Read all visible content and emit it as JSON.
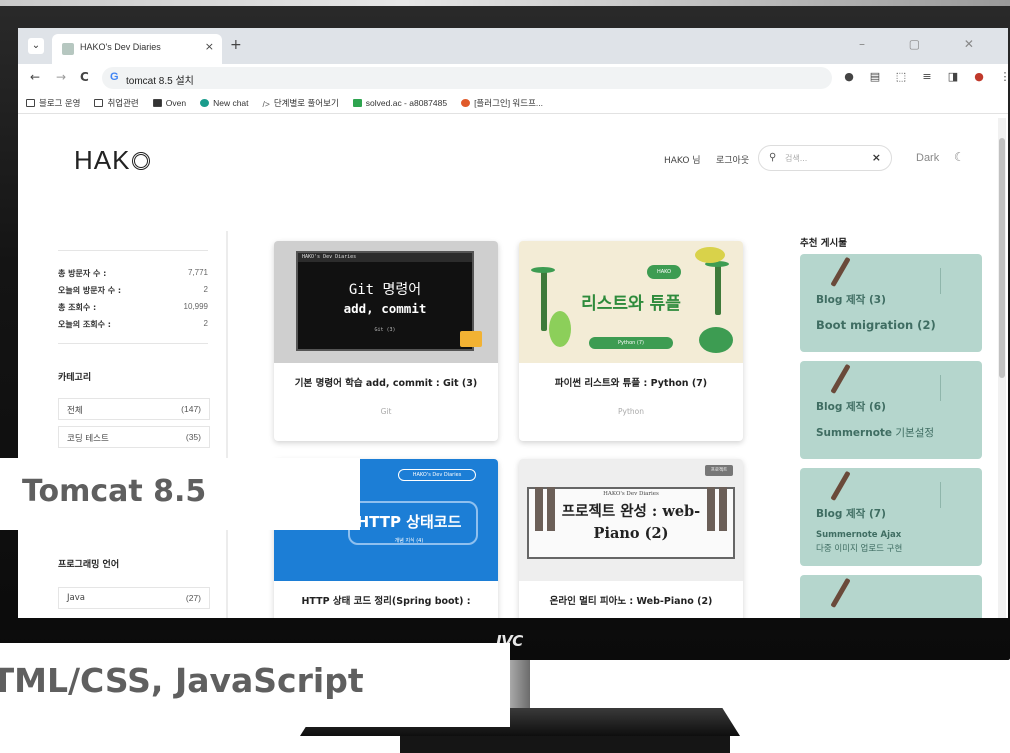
{
  "browser": {
    "tab_title": "HAKO's Dev Diaries",
    "tab_close": "×",
    "new_tab": "+",
    "window_controls": "–  ▢  ✕",
    "url": "tomcat 8.5 설치",
    "url_icon": "G",
    "nav": {
      "back": "←",
      "forward": "→",
      "reload": "C"
    },
    "bookmarks": [
      {
        "label": "블로그 운영",
        "icon": "folder-icon"
      },
      {
        "label": "취업관련",
        "icon": "folder-icon"
      },
      {
        "label": "Oven",
        "icon": "oven-icon"
      },
      {
        "label": "New chat",
        "icon": "chatgpt-icon"
      },
      {
        "label": "단계별로 풀어보기",
        "icon": "code-icon"
      },
      {
        "label": "solved.ac - a8087485",
        "icon": "solvedac-icon"
      },
      {
        "label": "[플러그인] 워드프...",
        "icon": "wordpress-icon"
      }
    ]
  },
  "header": {
    "logo": "HAK",
    "user": "HAKO 님",
    "logout": "로그아웃",
    "search_placeholder": "검색...",
    "search_clear": "×",
    "theme_label": "Dark",
    "theme_icon": "☾"
  },
  "sidebar": {
    "stats": [
      {
        "label": "총 방문자 수 :",
        "value": "7,771"
      },
      {
        "label": "오늘의 방문자 수 :",
        "value": "2"
      },
      {
        "label": "총 조회수 :",
        "value": "10,999"
      },
      {
        "label": "오늘의 조회수 :",
        "value": "2"
      }
    ],
    "category_heading": "카테고리",
    "categories": [
      {
        "name": "전체",
        "count": "(147)"
      },
      {
        "name": "코딩 테스트",
        "count": "(35)"
      }
    ],
    "lang_heading": "프로그래밍 언어",
    "lang_items": [
      {
        "name": "Java",
        "count": "(27)"
      }
    ]
  },
  "posts": [
    {
      "title": "기본 명령어 학습 add, commit : Git (3)",
      "category": "Git",
      "thumb_bar": "HAKO's Dev Diaries",
      "thumb_line1": "Git 명령어",
      "thumb_line2": "add, commit",
      "thumb_line3": "Git (3)"
    },
    {
      "title": "파이썬 리스트와 튜플 : Python (7)",
      "category": "Python",
      "thumb_title": "리스트와 튜플",
      "thumb_pill": "Python (7)",
      "thumb_tag": "HAKO"
    },
    {
      "title": "HTTP 상태 코드 정리(Spring boot) :",
      "category": "",
      "thumb_pill": "HAKO's Dev Diaries",
      "thumb_text": "HTTP 상태코드",
      "thumb_sub": "개념 지식 (4)"
    },
    {
      "title": "온라인 멀티 피아노 : Web-Piano (2)",
      "category": "",
      "thumb_head": "HAKO's Dev Diaries",
      "thumb_title": "프로젝트 완성 : web-Piano (2)",
      "thumb_badge": "프로젝트"
    }
  ],
  "recommended": {
    "heading": "추천 게시물",
    "items": [
      {
        "line1": "Blog 제작 (3)",
        "line2": "Boot migration (2)",
        "line3": ""
      },
      {
        "line1": "Blog 제작 (6)",
        "line2_bold": "Summernote",
        "line2_light": " 기본설정",
        "line3": ""
      },
      {
        "line1": "Blog 제작 (7)",
        "line2": "Summernote  Ajax",
        "line3": "다중 이미지 업로드 구현"
      }
    ]
  },
  "monitor": {
    "brand": "JVC"
  },
  "captions": {
    "top": "Tomcat 8.5",
    "bottom": "HTML/CSS, JavaScript"
  },
  "colors": {
    "rec_card": "#b5d6cd",
    "rec_text": "#3f6d62",
    "http_blue": "#1c7ed6",
    "python_green": "#2e8b3c"
  }
}
